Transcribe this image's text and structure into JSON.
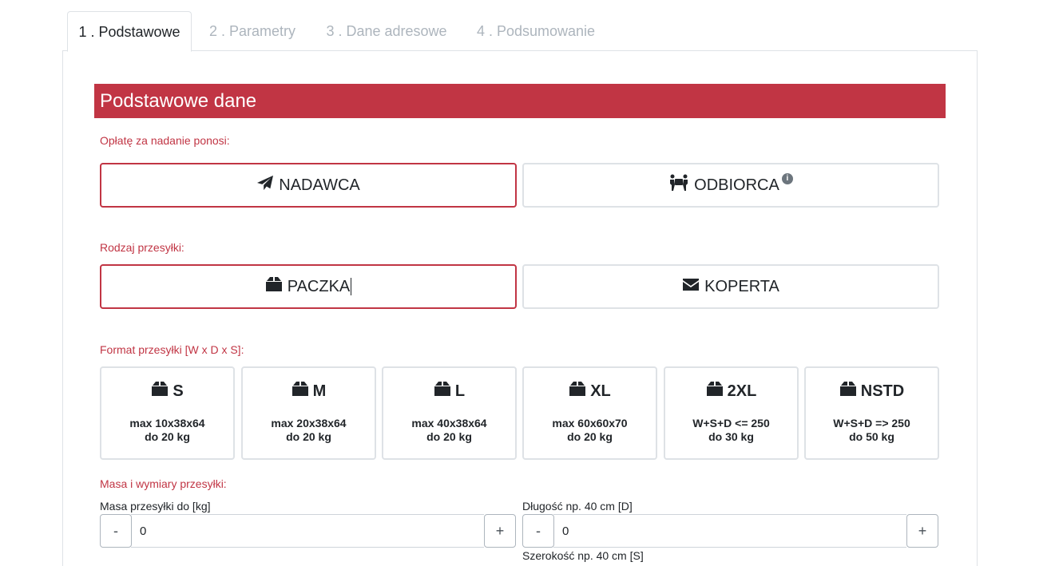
{
  "tabs": [
    {
      "label": "1 . Podstawowe",
      "active": true
    },
    {
      "label": "2 . Parametry",
      "active": false
    },
    {
      "label": "3 . Dane adresowe",
      "active": false
    },
    {
      "label": "4 . Podsumowanie",
      "active": false
    }
  ],
  "header": {
    "title": "Podstawowe dane"
  },
  "payer": {
    "label": "Opłatę za nadanie ponosi:",
    "options": [
      {
        "label": "NADAWCA",
        "icon": "paper-plane-icon",
        "selected": true
      },
      {
        "label": "ODBIORCA",
        "icon": "people-carry-icon",
        "selected": false,
        "info_icon": "info-icon"
      }
    ]
  },
  "shipment_type": {
    "label": "Rodzaj przesyłki:",
    "options": [
      {
        "label": "PACZKA",
        "icon": "box-icon",
        "selected": true
      },
      {
        "label": "KOPERTA",
        "icon": "envelope-icon",
        "selected": false
      }
    ]
  },
  "format": {
    "label": "Format przesyłki [W x D x S]:",
    "options": [
      {
        "size": "S",
        "dims": "max 10x38x64",
        "weight": "do 20 kg",
        "icon": "box-icon"
      },
      {
        "size": "M",
        "dims": "max 20x38x64",
        "weight": "do 20 kg",
        "icon": "box-icon"
      },
      {
        "size": "L",
        "dims": "max 40x38x64",
        "weight": "do 20 kg",
        "icon": "box-icon"
      },
      {
        "size": "XL",
        "dims": "max 60x60x70",
        "weight": "do 20 kg",
        "icon": "box-icon"
      },
      {
        "size": "2XL",
        "dims": "W+S+D <= 250",
        "weight": "do 30 kg",
        "icon": "box-icon"
      },
      {
        "size": "NSTD",
        "dims": "W+S+D => 250",
        "weight": "do 50 kg",
        "icon": "box-icon"
      }
    ]
  },
  "dimensions": {
    "label": "Masa i wymiary przesyłki:",
    "mass": {
      "label": "Masa przesyłki do [kg]",
      "value": "0",
      "minus": "-",
      "plus": "+"
    },
    "length": {
      "label": "Długość np. 40 cm [D]",
      "value": "0",
      "minus": "-",
      "plus": "+"
    },
    "width": {
      "label": "Szerokość np. 40 cm [S]"
    }
  },
  "colors": {
    "accent": "#c13544",
    "border": "#dee2e6"
  }
}
